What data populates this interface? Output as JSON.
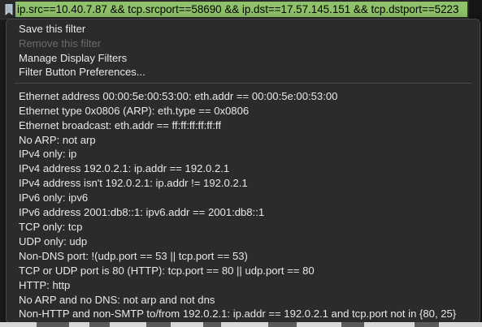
{
  "filter_bar": {
    "bookmark_icon": "bookmark-icon",
    "value": "ip.src==10.40.7.87 && tcp.srcport==58690 && ip.dst==17.57.145.151 && tcp.dstport==5223",
    "valid_color": "#8fc26a"
  },
  "menu": {
    "actions": [
      {
        "label": "Save this filter",
        "enabled": true
      },
      {
        "label": "Remove this filter",
        "enabled": false
      },
      {
        "label": "Manage Display Filters",
        "enabled": true
      },
      {
        "label": "Filter Button Preferences...",
        "enabled": true
      }
    ],
    "saved_filters": [
      "Ethernet address 00:00:5e:00:53:00: eth.addr == 00:00:5e:00:53:00",
      "Ethernet type 0x0806 (ARP): eth.type == 0x0806",
      "Ethernet broadcast: eth.addr == ff:ff:ff:ff:ff:ff",
      "No ARP: not arp",
      "IPv4 only: ip",
      "IPv4 address 192.0.2.1: ip.addr == 192.0.2.1",
      "IPv4 address isn't 192.0.2.1: ip.addr != 192.0.2.1",
      "IPv6 only: ipv6",
      "IPv6 address 2001:db8::1: ipv6.addr == 2001:db8::1",
      "TCP only: tcp",
      "UDP only: udp",
      "Non-DNS port: !(udp.port == 53 || tcp.port == 53)",
      "TCP or UDP port is 80 (HTTP): tcp.port == 80 || udp.port == 80",
      "HTTP: http",
      "No ARP and no DNS: not arp and not dns",
      "Non-HTTP and non-SMTP to/from 192.0.2.1: ip.addr == 192.0.2.1 and tcp.port not in {80, 25}"
    ]
  }
}
